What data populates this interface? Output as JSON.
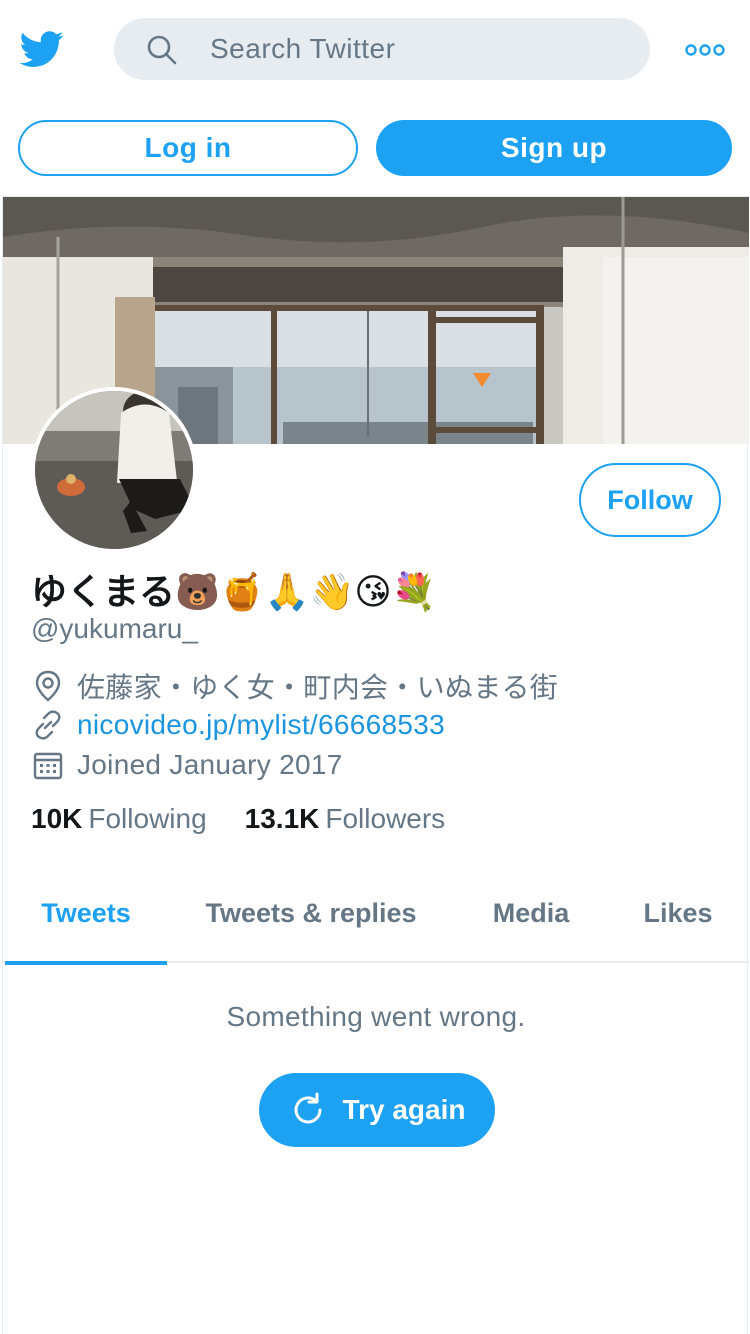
{
  "header": {
    "search_placeholder": "Search Twitter",
    "login_label": "Log in",
    "signup_label": "Sign up"
  },
  "profile": {
    "follow_label": "Follow",
    "display_name": "ゆくまる🐻🍯🙏👋😘💐",
    "handle": "@yukumaru_",
    "location": "佐藤家・ゆく女・町内会・いぬまる街",
    "website": "nicovideo.jp/mylist/66668533",
    "joined": "Joined January 2017",
    "following_count": "10K",
    "following_label": "Following",
    "followers_count": "13.1K",
    "followers_label": "Followers"
  },
  "tabs": [
    {
      "label": "Tweets",
      "active": true
    },
    {
      "label": "Tweets & replies",
      "active": false
    },
    {
      "label": "Media",
      "active": false
    },
    {
      "label": "Likes",
      "active": false
    }
  ],
  "error": {
    "message": "Something went wrong.",
    "retry_label": "Try again"
  },
  "colors": {
    "accent": "#1da1f2",
    "secondary_text": "#657786",
    "primary_text": "#14171a",
    "search_bg": "#e6ecf0"
  },
  "icons": [
    "twitter-bird-icon",
    "search-icon",
    "more-icon",
    "location-icon",
    "link-icon",
    "calendar-icon",
    "refresh-icon"
  ]
}
